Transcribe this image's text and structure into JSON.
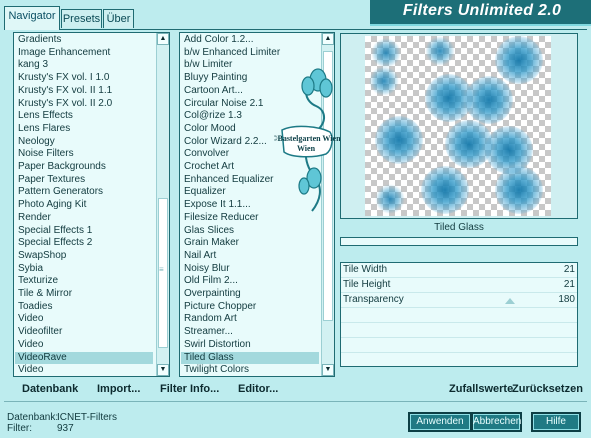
{
  "window": {
    "title": "Filters Unlimited 2.0"
  },
  "tabs": [
    {
      "label": "Navigator",
      "active": true
    },
    {
      "label": "Presets",
      "active": false
    },
    {
      "label": "Über",
      "active": false
    }
  ],
  "categories": {
    "items": [
      "Gradients",
      "Image Enhancement",
      "kang 3",
      "Krusty's FX vol. I 1.0",
      "Krusty's FX vol. II 1.1",
      "Krusty's FX vol. II 2.0",
      "Lens Effects",
      "Lens Flares",
      "Neology",
      "Noise Filters",
      "Paper Backgrounds",
      "Paper Textures",
      "Pattern Generators",
      "Photo Aging Kit",
      "Render",
      "Special Effects 1",
      "Special Effects 2",
      "SwapShop",
      "Sybia",
      "Texturize",
      "Tile & Mirror",
      "Toadies",
      "Video",
      "Videofilter",
      "Video",
      "VideoRave",
      "Video"
    ],
    "selected": "VideoRave"
  },
  "filters": {
    "items": [
      "Add Color 1.2...",
      "b/w Enhanced Limiter",
      "b/w Limiter",
      "Bluyy Painting",
      "Cartoon Art...",
      "Circular Noise 2.1",
      "Col@rize 1.3",
      "Color Mood",
      "Color Wizard 2.2...",
      "Convolver",
      "Crochet Art",
      "Enhanced Equalizer",
      "Equalizer",
      "Expose It 1.1...",
      "Filesize Reducer",
      "Glas Slices",
      "Grain Maker",
      "Nail Art",
      "Noisy Blur",
      "Old Film 2...",
      "Overpainting",
      "Picture Chopper",
      "Random Art",
      "Streamer...",
      "Swirl Distortion",
      "Tiled Glass",
      "Twilight Colors"
    ],
    "selected": "Tiled Glass"
  },
  "preview": {
    "caption": "Tiled Glass",
    "watermark": "©Bastelgarten Wien"
  },
  "params": [
    {
      "label": "Tile Width",
      "value": "21"
    },
    {
      "label": "Tile Height",
      "value": "21"
    },
    {
      "label": "Transparency",
      "value": "180"
    }
  ],
  "toolbar": {
    "database": "Datenbank",
    "import": "Import...",
    "filter_info": "Filter Info...",
    "editor": "Editor...",
    "random": "Zufallswerte",
    "reset": "Zurücksetzen"
  },
  "status": {
    "db_label": "Datenbank:",
    "db_value": "ICNET-Filters",
    "filter_label": "Filter:",
    "filter_value": "937"
  },
  "buttons": {
    "apply": "Anwenden",
    "cancel": "Abbrechen",
    "help": "Hilfe"
  },
  "colors": {
    "accent": "#1f7a84",
    "background": "#bdecee",
    "selection": "#a3d9dd"
  }
}
